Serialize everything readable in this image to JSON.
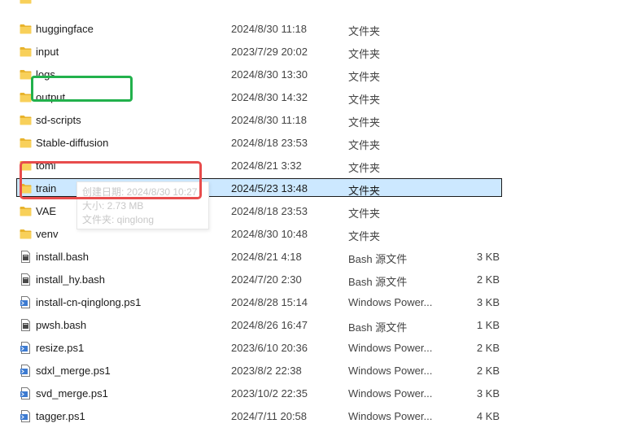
{
  "files": [
    {
      "name": "",
      "date": "",
      "type": "",
      "size": "",
      "icon": "folder-icon",
      "partial": true
    },
    {
      "name": "huggingface",
      "date": "2024/8/30 11:18",
      "type": "文件夹",
      "size": "",
      "icon": "folder-icon"
    },
    {
      "name": "input",
      "date": "2023/7/29 20:02",
      "type": "文件夹",
      "size": "",
      "icon": "folder-icon"
    },
    {
      "name": "logs",
      "date": "2024/8/30 13:30",
      "type": "文件夹",
      "size": "",
      "icon": "folder-icon"
    },
    {
      "name": "output",
      "date": "2024/8/30 14:32",
      "type": "文件夹",
      "size": "",
      "icon": "folder-icon"
    },
    {
      "name": "sd-scripts",
      "date": "2024/8/30 11:18",
      "type": "文件夹",
      "size": "",
      "icon": "folder-icon"
    },
    {
      "name": "Stable-diffusion",
      "date": "2024/8/18 23:53",
      "type": "文件夹",
      "size": "",
      "icon": "folder-icon"
    },
    {
      "name": "toml",
      "date": "2024/8/21 3:32",
      "type": "文件夹",
      "size": "",
      "icon": "folder-icon"
    },
    {
      "name": "train",
      "date": "2024/5/23 13:48",
      "type": "文件夹",
      "size": "",
      "icon": "folder-icon",
      "selected": true
    },
    {
      "name": "VAE",
      "date": "2024/8/18 23:53",
      "type": "文件夹",
      "size": "",
      "icon": "folder-icon"
    },
    {
      "name": "venv",
      "date": "2024/8/30 10:48",
      "type": "文件夹",
      "size": "",
      "icon": "folder-icon"
    },
    {
      "name": "install.bash",
      "date": "2024/8/21 4:18",
      "type": "Bash 源文件",
      "size": "3 KB",
      "icon": "bash-file-icon"
    },
    {
      "name": "install_hy.bash",
      "date": "2024/7/20 2:30",
      "type": "Bash 源文件",
      "size": "2 KB",
      "icon": "bash-file-icon"
    },
    {
      "name": "install-cn-qinglong.ps1",
      "date": "2024/8/28 15:14",
      "type": "Windows Power...",
      "size": "3 KB",
      "icon": "powershell-file-icon"
    },
    {
      "name": "pwsh.bash",
      "date": "2024/8/26 16:47",
      "type": "Bash 源文件",
      "size": "1 KB",
      "icon": "bash-file-icon"
    },
    {
      "name": "resize.ps1",
      "date": "2023/6/10 20:36",
      "type": "Windows Power...",
      "size": "2 KB",
      "icon": "powershell-file-icon"
    },
    {
      "name": "sdxl_merge.ps1",
      "date": "2023/8/2 22:38",
      "type": "Windows Power...",
      "size": "2 KB",
      "icon": "powershell-file-icon"
    },
    {
      "name": "svd_merge.ps1",
      "date": "2023/10/2 22:35",
      "type": "Windows Power...",
      "size": "3 KB",
      "icon": "powershell-file-icon"
    },
    {
      "name": "tagger.ps1",
      "date": "2024/7/11 20:58",
      "type": "Windows Power...",
      "size": "4 KB",
      "icon": "powershell-file-icon"
    }
  ],
  "tooltip": {
    "created": "创建日期: 2024/8/30 10:27",
    "size": "大小: 2.73 MB",
    "folders": "文件夹: qinglong"
  },
  "colors": {
    "folder": "#f3c646",
    "selection": "#cce8ff",
    "highlight_green": "#22b14c",
    "highlight_red": "#e84c4c"
  }
}
